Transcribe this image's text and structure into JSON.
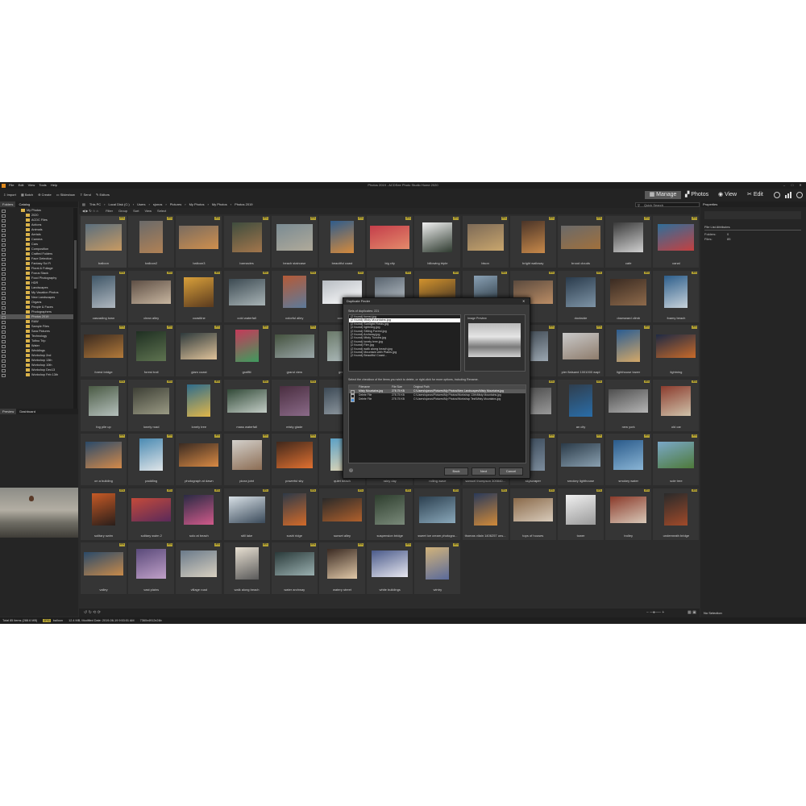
{
  "window": {
    "title": "Photos 2019 - ACDSee Photo Studio Home 2020",
    "menu": [
      "File",
      "Edit",
      "View",
      "Tools",
      "Help"
    ],
    "controls": [
      "–",
      "□",
      "✕"
    ]
  },
  "toolbar": {
    "items": [
      "Import",
      "Batch",
      "Create",
      "Slideshow",
      "Send",
      "Editors"
    ],
    "modes": {
      "manage": "Manage",
      "photos": "Photos",
      "view": "View",
      "edit": "Edit"
    }
  },
  "left_panel": {
    "tabs": [
      "Folders",
      "Catalog"
    ],
    "root": "My Photos",
    "folders": [
      "2020",
      "ACDC Files",
      "Actions",
      "Animals",
      "Aerials",
      "Camera",
      "Cars",
      "Composition",
      "Crafted Folders",
      "Face Detection",
      "Fantasy Sci Fi",
      "Floral & Foliage",
      "Focus Stack",
      "Food Photography",
      "HDR",
      "Landscapes",
      "My Vacation Photos",
      "New Landscapes",
      "Organs",
      "People & Faces",
      "Photographers",
      "Photos 2019",
      "RAW",
      "Sample Files",
      "Sara Pictures",
      "Technology",
      "Tofino Trip",
      "Water",
      "Weddings",
      "Workshop 2nd",
      "Workshop 13th",
      "Workshop 10th",
      "Workshop Dec13",
      "Workshop Feb 13th"
    ],
    "selected_folder": "Photos 2019",
    "preview_tabs": [
      "Preview",
      "Dashboard"
    ]
  },
  "address": {
    "crumbs": [
      "This PC",
      "Local Disk (C:)",
      "Users",
      "sjonos",
      "Pictures",
      "My Photos",
      "My Photos",
      "Photos 2019"
    ],
    "search_placeholder": "Quick Search"
  },
  "filterbar": [
    "Filter",
    "Group",
    "Sort",
    "View",
    "Select"
  ],
  "thumbnails": [
    {
      "label": "balloon",
      "colors": [
        "#5a6e7e",
        "#c89a62"
      ]
    },
    {
      "label": "balloon2",
      "colors": [
        "#6a6a6a",
        "#b08155"
      ]
    },
    {
      "label": "balloon3",
      "colors": [
        "#7a6c60",
        "#cf8f4d"
      ]
    },
    {
      "label": "barnacles",
      "colors": [
        "#3f4d3e",
        "#a3764c"
      ]
    },
    {
      "label": "beach staircase",
      "colors": [
        "#7a8b93",
        "#b0aa9a"
      ]
    },
    {
      "label": "beautiful coast",
      "colors": [
        "#2f5c8c",
        "#d58a3c"
      ]
    },
    {
      "label": "big city",
      "colors": [
        "#c43e4a",
        "#e48a6b"
      ]
    },
    {
      "label": "billowing triple",
      "colors": [
        "#f0f0f0",
        "#2e3a2f"
      ]
    },
    {
      "label": "bison",
      "colors": [
        "#7d6a57",
        "#c9a66d"
      ]
    },
    {
      "label": "bright walkway",
      "colors": [
        "#4a3428",
        "#c8894a"
      ]
    },
    {
      "label": "brood clouds",
      "colors": [
        "#6a6a6a",
        "#a0703c"
      ]
    },
    {
      "label": "cafe",
      "colors": [
        "#3a3a3a",
        "#d0d0d0"
      ]
    },
    {
      "label": "canal",
      "colors": [
        "#2f6f9a",
        "#c54040"
      ]
    },
    {
      "label": "cascading town",
      "colors": [
        "#3e5566",
        "#b0b8c0"
      ]
    },
    {
      "label": "clean alley",
      "colors": [
        "#5e4f45",
        "#c8b6a0"
      ]
    },
    {
      "label": "coastline",
      "colors": [
        "#d9a03a",
        "#5a3a1e"
      ]
    },
    {
      "label": "cold waterfall",
      "colors": [
        "#3c4a52",
        "#a9b4b6"
      ]
    },
    {
      "label": "colorful alley",
      "colors": [
        "#b55a37",
        "#5d7a9a"
      ]
    },
    {
      "label": "conc...",
      "colors": [
        "#b7bcc2",
        "#ffffff"
      ]
    },
    {
      "label": "",
      "colors": [
        "#58636e",
        "#c4ccd2"
      ]
    },
    {
      "label": "",
      "colors": [
        "#d3932d",
        "#3c2f24"
      ]
    },
    {
      "label": "",
      "colors": [
        "#8aa1b5",
        "#24313a"
      ]
    },
    {
      "label": "",
      "colors": [
        "#5b4a3e",
        "#bb8d65"
      ]
    },
    {
      "label": "dockside",
      "colors": [
        "#2a3b4c",
        "#7e94a6"
      ]
    },
    {
      "label": "downward climb",
      "colors": [
        "#3a2b22",
        "#8e6a4b"
      ]
    },
    {
      "label": "foamy beach",
      "colors": [
        "#2d5e8b",
        "#c7d2da"
      ]
    },
    {
      "label": "forest bridge",
      "colors": [
        "#3a2a20",
        "#b37a3a"
      ]
    },
    {
      "label": "forest trail",
      "colors": [
        "#1f2f22",
        "#5e7350"
      ]
    },
    {
      "label": "glam coast",
      "colors": [
        "#2e3a3c",
        "#e0c39a"
      ]
    },
    {
      "label": "graffiti",
      "colors": [
        "#c53a5a",
        "#3f9b5e"
      ]
    },
    {
      "label": "grand view",
      "colors": [
        "#44523e",
        "#9aa6a8"
      ]
    },
    {
      "label": "great",
      "colors": [
        "#6b7a6a",
        "#b3c0c2"
      ]
    },
    {
      "label": "",
      "colors": [
        "#3b3b3b",
        "#9a9a9a"
      ]
    },
    {
      "label": "",
      "colors": [
        "#4e4e4e",
        "#b0b0b0"
      ]
    },
    {
      "label": "",
      "colors": [
        "#2c3a48",
        "#7c8ea0"
      ]
    },
    {
      "label": "",
      "colors": [
        "#3c4650",
        "#9ba6b0"
      ]
    },
    {
      "label": "pier flatsand 1001000 wapl",
      "colors": [
        "#c9c9c9",
        "#8e7c6c"
      ]
    },
    {
      "label": "lighthouse tower",
      "colors": [
        "#2a5c92",
        "#d4a868"
      ]
    },
    {
      "label": "lightning",
      "colors": [
        "#1e2a44",
        "#c86a2a"
      ]
    },
    {
      "label": "fog pile up",
      "colors": [
        "#4a5a44",
        "#b5c0bc"
      ]
    },
    {
      "label": "lonely road",
      "colors": [
        "#3e4036",
        "#9a9a84"
      ]
    },
    {
      "label": "lonely tree",
      "colors": [
        "#2e6c8c",
        "#e0b64a"
      ]
    },
    {
      "label": "mass waterfall",
      "colors": [
        "#324a38",
        "#c3cdc6"
      ]
    },
    {
      "label": "misty glade",
      "colors": [
        "#4a2e40",
        "#8a6a88"
      ]
    },
    {
      "label": "",
      "colors": [
        "#3d4a56",
        "#9aa3aa"
      ]
    },
    {
      "label": "",
      "colors": [
        "#4b4b4b",
        "#9b9b9b"
      ]
    },
    {
      "label": "",
      "colors": [
        "#3a3a3a",
        "#6c6c6c"
      ]
    },
    {
      "label": "",
      "colors": [
        "#3e4e5e",
        "#8a9aaa"
      ]
    },
    {
      "label": "",
      "colors": [
        "#444444",
        "#999999"
      ]
    },
    {
      "label": "an city",
      "colors": [
        "#2f3e4e",
        "#2a6da8"
      ]
    },
    {
      "label": "new york",
      "colors": [
        "#4f4f4f",
        "#b5b5b5"
      ]
    },
    {
      "label": "old car",
      "colors": [
        "#8b3c2e",
        "#cfc2aa"
      ]
    },
    {
      "label": "on a building",
      "colors": [
        "#2a4a6a",
        "#d48a4a"
      ]
    },
    {
      "label": "paddling",
      "colors": [
        "#4a8ab2",
        "#e0e5e8"
      ]
    },
    {
      "label": "photograph at dawn",
      "colors": [
        "#3a2b22",
        "#d98a44"
      ]
    },
    {
      "label": "pizza joint",
      "colors": [
        "#d3d0cb",
        "#8c6d54"
      ]
    },
    {
      "label": "powerful sky",
      "colors": [
        "#40281c",
        "#e07030"
      ]
    },
    {
      "label": "quiet beach",
      "colors": [
        "#5aa0c6",
        "#e8d9b5"
      ]
    },
    {
      "label": "rainy day",
      "colors": [
        "#5a5a5a",
        "#a8a8a8"
      ]
    },
    {
      "label": "rolling wave",
      "colors": [
        "#3a5a7a",
        "#8ab0c8"
      ]
    },
    {
      "label": "samuel thompson 309840...",
      "colors": [
        "#4a3a30",
        "#a88a6a"
      ]
    },
    {
      "label": "skyscraper",
      "colors": [
        "#3b4a5a",
        "#7c8c9c"
      ]
    },
    {
      "label": "smokey lighthouse",
      "colors": [
        "#2a3a48",
        "#8aa0b0"
      ]
    },
    {
      "label": "smokey water",
      "colors": [
        "#2a5a8a",
        "#8ab5d5"
      ]
    },
    {
      "label": "sole tree",
      "colors": [
        "#7aa8c8",
        "#4e7a3a"
      ]
    },
    {
      "label": "solitary swim",
      "colors": [
        "#c65a26",
        "#2a1e1a"
      ]
    },
    {
      "label": "solitary swim 2",
      "colors": [
        "#c44a3a",
        "#5a2a5a"
      ]
    },
    {
      "label": "solo at beach",
      "colors": [
        "#2a2a44",
        "#d05a8a"
      ]
    },
    {
      "label": "still lake",
      "colors": [
        "#d8e0e6",
        "#3a4a5a"
      ]
    },
    {
      "label": "sushi ridge",
      "colors": [
        "#2e3a48",
        "#d26a2a"
      ]
    },
    {
      "label": "sunset alley",
      "colors": [
        "#2a2a2a",
        "#b0602c"
      ]
    },
    {
      "label": "suspension bridge",
      "colors": [
        "#2e3e2e",
        "#7a8a7a"
      ]
    },
    {
      "label": "sweet ice cream photogra...",
      "colors": [
        "#2c4050",
        "#8aa8ba"
      ]
    },
    {
      "label": "thomas vilain 1406257 uns...",
      "colors": [
        "#2a3a5a",
        "#d08a3a"
      ]
    },
    {
      "label": "tops of houses",
      "colors": [
        "#8a6a4a",
        "#d8cbbb"
      ]
    },
    {
      "label": "tower",
      "colors": [
        "#f0f0f0",
        "#9a9a9a"
      ]
    },
    {
      "label": "trolley",
      "colors": [
        "#8a3a2a",
        "#d8c8b8"
      ]
    },
    {
      "label": "underneath bridge",
      "colors": [
        "#2a2a2a",
        "#a04a2a"
      ]
    },
    {
      "label": "valley",
      "colors": [
        "#2a4a6a",
        "#c88a4a"
      ]
    },
    {
      "label": "vast plains",
      "colors": [
        "#5a4a7a",
        "#c0a0c8"
      ]
    },
    {
      "label": "village road",
      "colors": [
        "#6a7a8a",
        "#d8d0c0"
      ]
    },
    {
      "label": "walk along beach",
      "colors": [
        "#e8e0d2",
        "#5a5a5a"
      ]
    },
    {
      "label": "water archway",
      "colors": [
        "#2a3a3a",
        "#9ab0b0"
      ]
    },
    {
      "label": "watery street",
      "colors": [
        "#3a2a22",
        "#e0c8a8"
      ]
    },
    {
      "label": "white buildings",
      "colors": [
        "#4a5a8a",
        "#e8e8f0"
      ]
    },
    {
      "label": "wintry",
      "colors": [
        "#d2b37a",
        "#5a6a9a"
      ]
    }
  ],
  "dialog": {
    "title": "Duplicate Finder",
    "sets_label": "Sets of duplicates: 221",
    "preview_label": "Image Preview",
    "duplicates": [
      "(2 found) forest.jpg",
      "(2 found) Misty Mountains.jpg",
      "(2 found) Sunlight Fields.jpg",
      "(2 found) lightning.jpg",
      "(2 found) Sitting Forest.jpg",
      "(2 found) Archway.jpg",
      "(2 found) Misty Tundra.jpg",
      "(2 found) lonely tree.jpg",
      "(2 found) Fire.jpg",
      "(2 found) walk along beach.jpg",
      "(2 found) Mountain with Plains.jpg",
      "(2 found) Beautiful Coast..."
    ],
    "instructions": "Select the checkbox of the items you wish to delete, or right-click for more options, including Rename.",
    "columns": [
      "Filename",
      "File Size",
      "Original Path"
    ],
    "files": [
      {
        "name": "Misty Mountains.jpg",
        "size": "278.75 KB",
        "path": "C:\\Users\\sjonos\\Pictures\\My Photos\\New Landscapes\\Misty Mountains.jpg"
      },
      {
        "name": "Delete File",
        "size": "278.75 KB",
        "path": "C:\\Users\\sjonos\\Pictures\\My Photos\\Workshop 13th\\Misty Mountains.jpg"
      },
      {
        "name": "Delete File",
        "size": "278.75 KB",
        "path": "C:\\Users\\sjonos\\Pictures\\My Photos\\Workshop Test\\Misty Mountains.jpg"
      }
    ],
    "buttons": {
      "back": "Back",
      "next": "Next",
      "cancel": "Cancel"
    }
  },
  "properties": {
    "title": "Properties",
    "section": "File List Attributes",
    "rows": [
      {
        "k": "Folders:",
        "v": "0"
      },
      {
        "k": "Files:",
        "v": "85"
      }
    ],
    "footer": "No Selection"
  },
  "status": {
    "total": "Total 85 items (288.6 MB)",
    "badge": "JPG",
    "file": "balloon",
    "details": "12.4 MB, Modified Date: 2019-06-19 9:53:01 AM",
    "dims": "7360x4912x24b"
  }
}
